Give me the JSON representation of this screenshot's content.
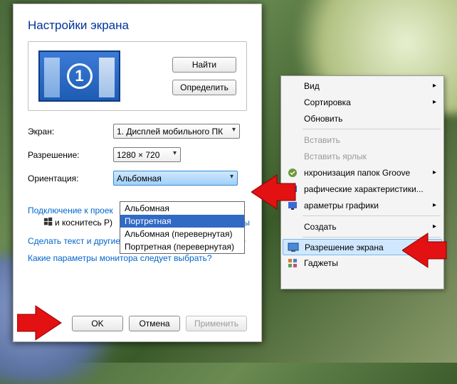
{
  "window": {
    "title": "Настройки экрана",
    "monitor_number": "1",
    "find_btn": "Найти",
    "detect_btn": "Определить",
    "screen_label": "Экран:",
    "screen_value": "1. Дисплей мобильного ПК",
    "resolution_label": "Разрешение:",
    "resolution_value": "1280 × 720",
    "orientation_label": "Ориентация:",
    "orientation_value": "Альбомная",
    "dropdown_options": [
      "Альбомная",
      "Портретная",
      "Альбомная (перевернутая)",
      "Портретная (перевернутая)"
    ],
    "dropdown_selected_index": 1,
    "projector_link": "Подключение к проек",
    "projector_hint": "и коснитесь P)",
    "text_size_link": "Сделать текст и другие элементы больше или меньше",
    "monitor_params_link": "Какие параметры монитора следует выбрать?",
    "partial_char": "ы",
    "ok_btn": "OK",
    "cancel_btn": "Отмена",
    "apply_btn": "Применить"
  },
  "context_menu": {
    "items": [
      {
        "label": "Вид",
        "arrow": true
      },
      {
        "label": "Сортировка",
        "arrow": true
      },
      {
        "label": "Обновить"
      },
      {
        "sep": true
      },
      {
        "label": "Вставить",
        "disabled": true
      },
      {
        "label": "Вставить ярлык",
        "disabled": true
      },
      {
        "label": "нхронизация папок Groove",
        "arrow": true,
        "icon": "groove"
      },
      {
        "label": "рафические характеристики...",
        "icon": "gfx"
      },
      {
        "label": "араметры графики",
        "arrow": true,
        "icon": "gfx"
      },
      {
        "sep": true
      },
      {
        "label": "Создать",
        "arrow": true
      },
      {
        "sep": true
      },
      {
        "label": "Разрешение экрана",
        "hl": true,
        "icon": "res"
      },
      {
        "label": "Гаджеты",
        "icon": "gadget"
      },
      {
        "label": "",
        "icon": null
      }
    ]
  }
}
